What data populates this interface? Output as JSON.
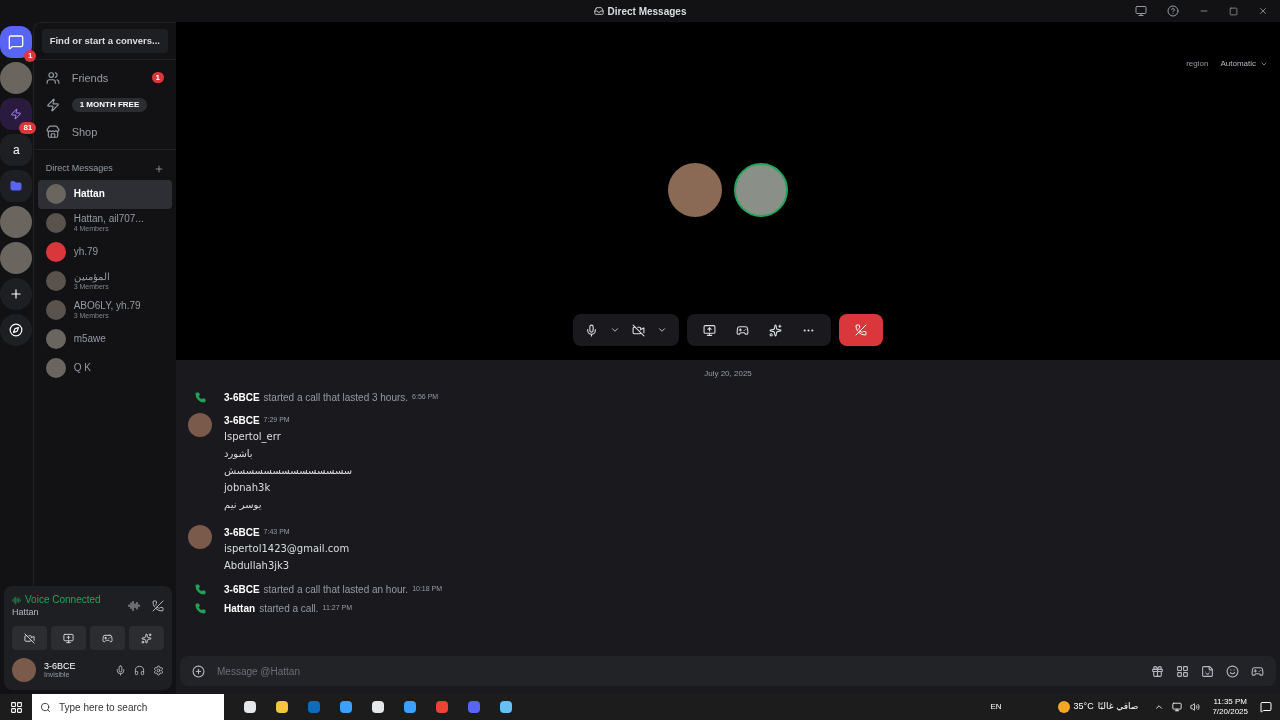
{
  "title_bar": {
    "title": "Direct Messages"
  },
  "server_rail": [
    {
      "kind": "home",
      "badge": "1"
    },
    {
      "kind": "avatar"
    },
    {
      "kind": "server",
      "badge": "81"
    },
    {
      "kind": "letter",
      "label": "a"
    },
    {
      "kind": "folder"
    },
    {
      "kind": "avatar"
    },
    {
      "kind": "avatar"
    },
    {
      "kind": "add"
    },
    {
      "kind": "discover"
    }
  ],
  "dm_sidebar": {
    "search": {
      "placeholder": "Find or start a convers..."
    },
    "nav": [
      {
        "kind": "friends",
        "label": "Friends",
        "badge": "1"
      },
      {
        "kind": "nitro",
        "badge": "1 MONTH FREE"
      },
      {
        "kind": "shop",
        "label": "Shop"
      }
    ],
    "section_title": "Direct Messages",
    "dms": [
      {
        "name": "Hattan",
        "selected": true,
        "kind": "user"
      },
      {
        "name": "Hattan, ail707...",
        "subtitle": "4 Members",
        "selected": false,
        "kind": "group"
      },
      {
        "name": "yh.79",
        "selected": false,
        "kind": "default"
      },
      {
        "name": "المؤمنين",
        "subtitle": "3 Members",
        "selected": false,
        "kind": "group"
      },
      {
        "name": "ABO6LY, yh.79",
        "subtitle": "3 Members",
        "selected": false,
        "kind": "group"
      },
      {
        "name": "m5awe",
        "selected": false,
        "kind": "user"
      },
      {
        "name": "Q K",
        "selected": false,
        "kind": "user"
      }
    ]
  },
  "voice_panel": {
    "status": "Voice Connected",
    "channel": "Hattan"
  },
  "user_panel": {
    "name": "3-6BCE",
    "status": "Invisible"
  },
  "call": {
    "region_label": "region",
    "region_value": "Automatic"
  },
  "chat": {
    "date": "July 20, 2025",
    "messages": [
      {
        "kind": "call",
        "author": "3-6BCE",
        "text": "started a call that lasted 3 hours.",
        "time": "6:56 PM"
      },
      {
        "kind": "message",
        "author": "3-6BCE",
        "time": "7:29 PM",
        "lines": [
          "Ispertol_err",
          "باشورد",
          "سسسسسسسسسسسسسش",
          "jobnah3k",
          "يوسر نيم"
        ]
      },
      {
        "kind": "message",
        "author": "3-6BCE",
        "time": "7:43 PM",
        "lines": [
          "ispertol1423@gmail.com",
          "Abdullah3jk3"
        ]
      },
      {
        "kind": "call",
        "author": "3-6BCE",
        "text": "started a call that lasted an hour.",
        "time": "10:18 PM"
      },
      {
        "kind": "call",
        "author": "Hattan",
        "text": "started a call.",
        "time": "11:27 PM"
      }
    ]
  },
  "composer": {
    "placeholder": "Message @Hattan"
  },
  "taskbar": {
    "search": {
      "placeholder": "Type here to search"
    },
    "language": "EN",
    "temperature": "35°C",
    "weather": "صافي غالبًا",
    "time": "11:35 PM",
    "date": "7/20/2025"
  }
}
